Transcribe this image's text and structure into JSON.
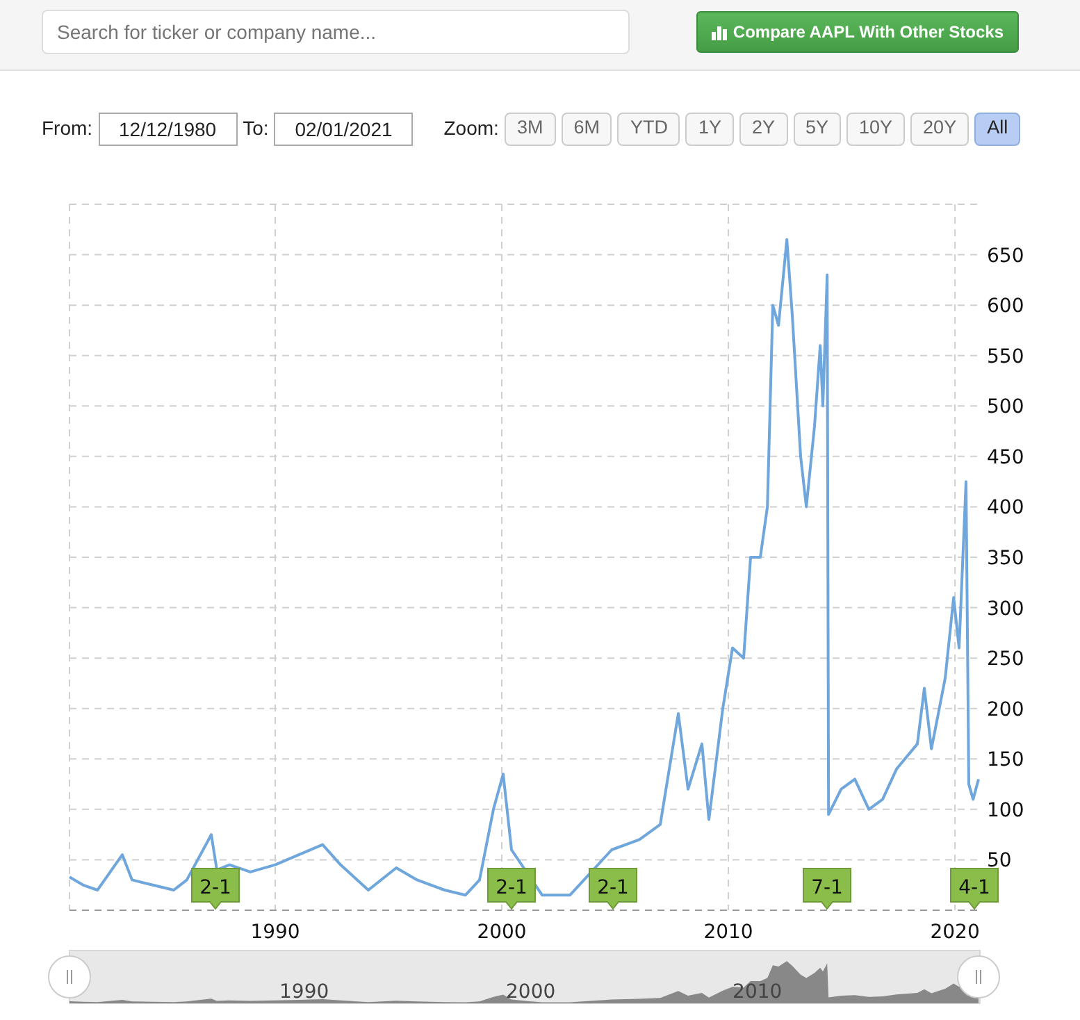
{
  "search": {
    "placeholder": "Search for ticker or company name..."
  },
  "compare_button": {
    "label": "Compare AAPL With Other Stocks"
  },
  "range": {
    "from_label": "From:",
    "from": "12/12/1980",
    "to_label": "To:",
    "to": "02/01/2021"
  },
  "zoom": {
    "label": "Zoom:",
    "buttons": [
      {
        "label": "3M",
        "selected": false
      },
      {
        "label": "6M",
        "selected": false
      },
      {
        "label": "YTD",
        "selected": false
      },
      {
        "label": "1Y",
        "selected": false
      },
      {
        "label": "2Y",
        "selected": false
      },
      {
        "label": "5Y",
        "selected": false
      },
      {
        "label": "10Y",
        "selected": false
      },
      {
        "label": "20Y",
        "selected": false
      },
      {
        "label": "All",
        "selected": true
      }
    ]
  },
  "chart": {
    "chart_data": {
      "type": "line",
      "grid": true,
      "xlim": [
        1980.92,
        2021.04
      ],
      "ylim": [
        0,
        700
      ],
      "xticks": [
        1990,
        2000,
        2010,
        2020
      ],
      "yticks": [
        50,
        100,
        150,
        200,
        250,
        300,
        350,
        400,
        450,
        500,
        550,
        600,
        650
      ],
      "x": [
        1980.92,
        1981.53,
        1982.15,
        1983.25,
        1983.68,
        1984.6,
        1985.52,
        1986.1,
        1987.18,
        1987.42,
        1987.98,
        1988.9,
        1990,
        1991.04,
        1992.09,
        1992.88,
        1994.11,
        1995.34,
        1996.26,
        1997.48,
        1998.4,
        1999.02,
        1999.63,
        2000.06,
        2000.43,
        2001.78,
        2003.01,
        2004.85,
        2006.07,
        2006.99,
        2007.79,
        2008.22,
        2008.83,
        2009.14,
        2009.75,
        2010.18,
        2010.67,
        2010.98,
        2011.41,
        2011.72,
        2011.96,
        2012.21,
        2012.58,
        2012.82,
        2013.19,
        2013.44,
        2013.8,
        2014.05,
        2014.17,
        2014.36,
        2014.42,
        2014.97,
        2015.58,
        2016.2,
        2016.81,
        2017.42,
        2018.34,
        2018.65,
        2018.96,
        2019.57,
        2019.94,
        2020.18,
        2020.49,
        2020.61,
        2020.8,
        2021.04
      ],
      "series": [
        {
          "color": "#6fa6dc",
          "values": [
            33,
            25,
            20,
            55,
            30,
            25,
            20,
            30,
            75,
            40,
            45,
            38,
            45,
            55,
            65,
            45,
            20,
            42,
            30,
            20,
            15,
            30,
            100,
            135,
            60,
            15,
            15,
            60,
            70,
            85,
            195,
            120,
            165,
            90,
            200,
            260,
            250,
            350,
            350,
            400,
            600,
            580,
            665,
            590,
            450,
            400,
            480,
            560,
            500,
            630,
            95,
            120,
            130,
            100,
            110,
            140,
            165,
            220,
            160,
            230,
            310,
            260,
            425,
            125,
            110,
            130
          ]
        }
      ]
    },
    "splits": [
      {
        "label": "2-1"
      },
      {
        "label": "2-1"
      },
      {
        "label": "2-1"
      },
      {
        "label": "7-1"
      },
      {
        "label": "4-1"
      }
    ],
    "navigator": {
      "labels": [
        "1990",
        "2000",
        "2010"
      ]
    }
  }
}
